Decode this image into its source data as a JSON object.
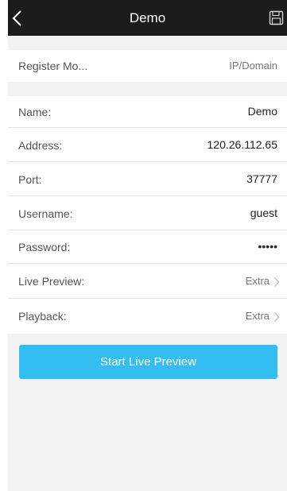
{
  "header": {
    "title": "Demo",
    "back_icon": "chevron-left-icon",
    "save_icon": "floppy-disk-icon"
  },
  "register": {
    "label": "Register Mo...",
    "value": "IP/Domain"
  },
  "fields": {
    "name": {
      "label": "Name:",
      "value": "Demo"
    },
    "address": {
      "label": "Address:",
      "value": "120.26.112.65"
    },
    "port": {
      "label": "Port:",
      "value": "37777"
    },
    "username": {
      "label": "Username:",
      "value": "guest"
    },
    "password": {
      "label": "Password:",
      "value": "•••••"
    },
    "live_preview": {
      "label": "Live Preview:",
      "value": "Extra"
    },
    "playback": {
      "label": "Playback:",
      "value": "Extra"
    }
  },
  "actions": {
    "start_label": "Start Live Preview"
  },
  "colors": {
    "nav_background": "#1c1c1c",
    "button": "#33bef2",
    "page_background": "#f2f2f2"
  }
}
